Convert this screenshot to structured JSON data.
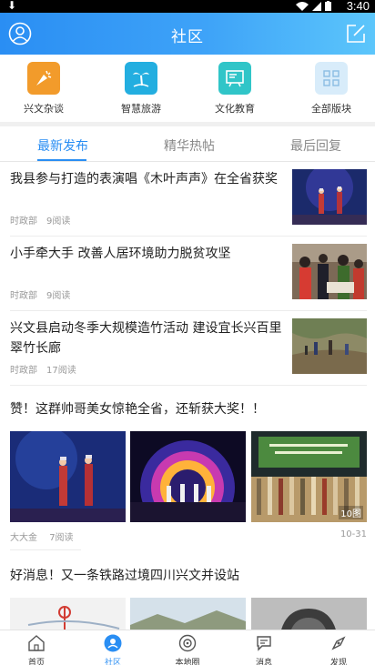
{
  "status_bar": {
    "time": "3:40"
  },
  "header": {
    "title": "社区"
  },
  "quick_links": [
    {
      "label": "兴文杂谈",
      "icon": "party-icon",
      "color": "#f29b2b"
    },
    {
      "label": "智慧旅游",
      "icon": "palm-tree-icon",
      "color": "#23aee0"
    },
    {
      "label": "文化教育",
      "icon": "blackboard-icon",
      "color": "#30c5c8"
    },
    {
      "label": "全部版块",
      "icon": "grid-icon",
      "color": "#d8ecfa"
    }
  ],
  "tabs": [
    {
      "label": "最新发布",
      "active": true
    },
    {
      "label": "精华热帖",
      "active": false
    },
    {
      "label": "最后回复",
      "active": false
    }
  ],
  "articles": [
    {
      "title": "我县参与打造的表演唱《木叶声声》在全省获奖",
      "author": "时政部",
      "reads": "9阅读"
    },
    {
      "title": "小手牵大手 改善人居环境助力脱贫攻坚",
      "author": "时政部",
      "reads": "9阅读"
    },
    {
      "title": "兴文县启动冬季大规模造竹活动 建设宜长兴百里翠竹长廊",
      "author": "时政部",
      "reads": "17阅读"
    }
  ],
  "gallery_post": {
    "title": "赞！这群帅哥美女惊艳全省，还斩获大奖！！",
    "author": "大大金",
    "reads": "7阅读",
    "date": "10-31",
    "image_count": "10图"
  },
  "gallery_post_2": {
    "title": "好消息！又一条铁路过境四川兴文并设站"
  },
  "bottom_nav": [
    {
      "label": "首页",
      "icon": "home-icon",
      "active": false
    },
    {
      "label": "社区",
      "icon": "community-icon",
      "active": true
    },
    {
      "label": "本地圈",
      "icon": "local-circle-icon",
      "active": false
    },
    {
      "label": "消息",
      "icon": "message-icon",
      "active": false
    },
    {
      "label": "发现",
      "icon": "discover-icon",
      "active": false
    }
  ],
  "colors": {
    "primary": "#2a8ef3",
    "header_gradient_end": "#5cc6fb"
  }
}
